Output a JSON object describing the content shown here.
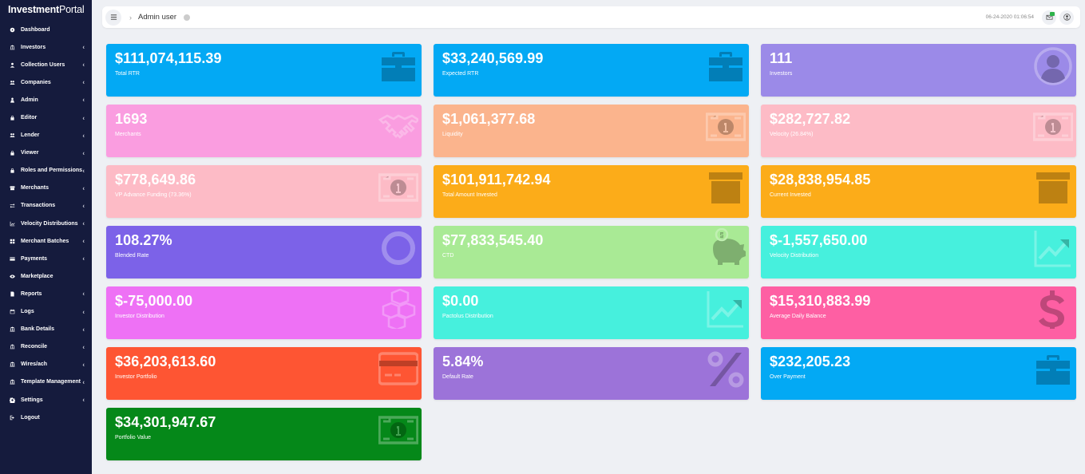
{
  "app": {
    "brand_bold": "Investment",
    "brand_rest": "Portal"
  },
  "sidebar": {
    "items": [
      {
        "label": "Dashboard",
        "icon": "dashboard-icon",
        "has_children": false
      },
      {
        "label": "Investors",
        "icon": "investors-icon",
        "has_children": true
      },
      {
        "label": "Collection Users",
        "icon": "user-icon",
        "has_children": true
      },
      {
        "label": "Companies",
        "icon": "users-icon",
        "has_children": true
      },
      {
        "label": "Admin",
        "icon": "admin-icon",
        "has_children": true
      },
      {
        "label": "Editor",
        "icon": "lock-icon",
        "has_children": true
      },
      {
        "label": "Lender",
        "icon": "users-icon",
        "has_children": true
      },
      {
        "label": "Viewer",
        "icon": "lock-icon",
        "has_children": true
      },
      {
        "label": "Roles and Permissions",
        "icon": "lock-icon",
        "has_children": true
      },
      {
        "label": "Merchants",
        "icon": "store-icon",
        "has_children": true
      },
      {
        "label": "Transactions",
        "icon": "exchange-icon",
        "has_children": true
      },
      {
        "label": "Velocity Distributions",
        "icon": "chart-icon",
        "has_children": true
      },
      {
        "label": "Merchant Batches",
        "icon": "grid-icon",
        "has_children": true
      },
      {
        "label": "Payments",
        "icon": "card-icon",
        "has_children": true
      },
      {
        "label": "Marketplace",
        "icon": "eye-icon",
        "has_children": false
      },
      {
        "label": "Reports",
        "icon": "report-icon",
        "has_children": true
      },
      {
        "label": "Logs",
        "icon": "calendar-icon",
        "has_children": true
      },
      {
        "label": "Bank Details",
        "icon": "bank-icon",
        "has_children": true
      },
      {
        "label": "Reconcile",
        "icon": "investors-icon",
        "has_children": true
      },
      {
        "label": "Wires/ach",
        "icon": "bank-icon",
        "has_children": true
      },
      {
        "label": "Template Management",
        "icon": "bank-icon",
        "has_children": true
      },
      {
        "label": "Settings",
        "icon": "gear-icon",
        "has_children": true
      },
      {
        "label": "Logout",
        "icon": "logout-icon",
        "has_children": false
      }
    ]
  },
  "topbar": {
    "breadcrumb": "Admin user",
    "timestamp": "06-24-2020 01:06:54"
  },
  "cards": [
    {
      "value": "$111,074,115.39",
      "label": "Total RTR",
      "color": "#03a9f4",
      "icon": "briefcase-icon"
    },
    {
      "value": "$33,240,569.99",
      "label": "Expected RTR",
      "color": "#03a9f4",
      "icon": "briefcase-icon"
    },
    {
      "value": "111",
      "label": "Investors",
      "color": "#9b8ae8",
      "icon": "user-circle-icon"
    },
    {
      "value": "1693",
      "label": "Merchants",
      "color": "#fa9de0",
      "icon": "handshake-icon"
    },
    {
      "value": "$1,061,377.68",
      "label": "Liquidity",
      "color": "#fbb48d",
      "icon": "money-icon"
    },
    {
      "value": "$282,727.82",
      "label": "Velocity (26.84%)",
      "color": "#fdbbc6",
      "icon": "money-icon"
    },
    {
      "value": "$778,649.86",
      "label": "VP Advance Funding (73.36%)",
      "color": "#fdbbc6",
      "icon": "money-icon"
    },
    {
      "value": "$101,911,742.94",
      "label": "Total Amount Invested",
      "color": "#fcac19",
      "icon": "archive-icon"
    },
    {
      "value": "$28,838,954.85",
      "label": "Current Invested",
      "color": "#fcac19",
      "icon": "archive-icon"
    },
    {
      "value": "108.27%",
      "label": "Blended Rate",
      "color": "#7c62e8",
      "icon": "ring-icon"
    },
    {
      "value": "$77,833,545.40",
      "label": "CTD",
      "color": "#a9ea95",
      "icon": "piggy-bank-icon"
    },
    {
      "value": "$-1,557,650.00",
      "label": "Velocity Distribution",
      "color": "#46f0dd",
      "icon": "trend-up-icon"
    },
    {
      "value": "$-75,000.00",
      "label": "Investor Distribution",
      "color": "#ee71f5",
      "icon": "cubes-icon"
    },
    {
      "value": "$0.00",
      "label": "Pactolus Distribution",
      "color": "#46f0dd",
      "icon": "trend-up-icon"
    },
    {
      "value": "$15,310,883.99",
      "label": "Average Daily Balance",
      "color": "#fe5fa3",
      "icon": "dollar-icon"
    },
    {
      "value": "$36,203,613.60",
      "label": "Investor Portfolio",
      "color": "#fe5533",
      "icon": "credit-card-icon"
    },
    {
      "value": "5.84%",
      "label": "Default Rate",
      "color": "#9c73d9",
      "icon": "percent-icon"
    },
    {
      "value": "$232,205.23",
      "label": "Over Payment",
      "color": "#03a9f4",
      "icon": "briefcase-icon"
    },
    {
      "value": "$34,301,947.67",
      "label": "Portfolio Value",
      "color": "#058819",
      "icon": "money-icon"
    }
  ]
}
